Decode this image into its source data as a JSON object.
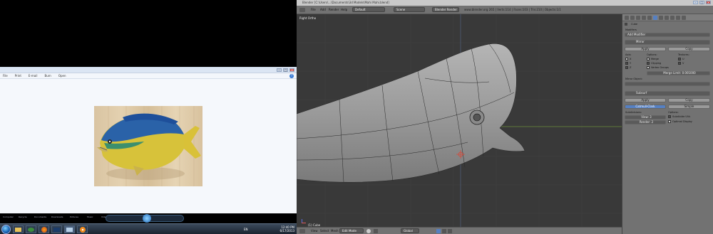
{
  "left_monitor": {
    "viewer": {
      "title": "",
      "menu": [
        "File",
        "Print",
        "E-mail",
        "Burn",
        "Open"
      ],
      "help_icon": "help-icon"
    },
    "taskbar": {
      "lang": "EN",
      "time": "12:40 PM",
      "date": "6/17/2013"
    },
    "desktop_labels": [
      "Computer",
      "Recycle",
      "Documents",
      "Downloads",
      "Pictures",
      "Music",
      "Videos",
      "Games"
    ]
  },
  "blender": {
    "window_title": "Blender [C:\\Users\\...\\Documents\\3d Models\\Mahi Mahi.blend]",
    "menu": [
      "File",
      "Add",
      "Render",
      "Help"
    ],
    "layout": "Default",
    "scene": "Scene",
    "engine": "Blender Render",
    "stats": "www.blender.org 265 | Verts:114 | Faces:103 | Tris:210 | Objects:1/1",
    "viewport_label": "Right Ortho",
    "object_label": "(1) Cube",
    "bottom": {
      "view": "View",
      "select": "Select",
      "mesh": "Mesh",
      "mode": "Edit Mode",
      "pivot": "Global"
    },
    "properties": {
      "object": "Cube",
      "add_modifier": "Add Modifier",
      "modifiers_title": "Modifiers",
      "mirror": {
        "name": "Mirror",
        "apply": "Apply",
        "copy": "Copy",
        "axis": "Axis:",
        "options": "Options:",
        "textures": "Textures:",
        "x": "X",
        "y": "Y",
        "z": "Z",
        "merge": "Merge",
        "clipping": "Clipping",
        "vertex_groups": "Vertex Groups",
        "u": "U",
        "v": "V",
        "merge_limit": "Merge Limit: 0.001000",
        "mirror_object": "Mirror Object:"
      },
      "subsurf": {
        "name": "Subsurf",
        "apply": "Apply",
        "copy": "Copy",
        "catmull": "Catmull-Clark",
        "simple": "Simple",
        "subdivisions": "Subdivisions:",
        "view": "View: 3",
        "render": "Render: 2",
        "options": "Options:",
        "subdivide_uvs": "Subdivide UVs",
        "optimal_display": "Optimal Display"
      }
    }
  }
}
